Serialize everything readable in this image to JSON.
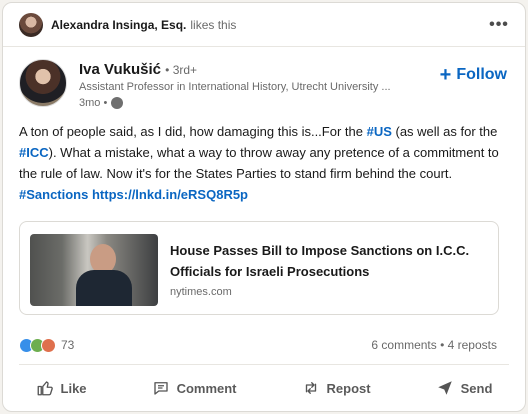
{
  "social_context": {
    "actor": "Alexandra Insinga, Esq.",
    "action": "likes this"
  },
  "author": {
    "name": "Iva Vukušić",
    "degree": "• 3rd+",
    "headline": "Assistant Professor in International History, Utrecht University ...",
    "time": "3mo •",
    "follow_label": "Follow"
  },
  "post": {
    "text_1": "A ton of people said, as I did, how damaging this is...For the ",
    "tag_us": "#US",
    "text_2": " (as well as for the ",
    "tag_icc": "#ICC",
    "text_3": "). What a mistake, what a way to throw away any pretence of a commitment to the rule of law. Now it's for the States Parties to stand firm behind the court. ",
    "tag_sanctions": "#Sanctions",
    "link": "https://lnkd.in/eRSQ8R5p"
  },
  "article": {
    "title": "House Passes Bill to Impose Sanctions on I.C.C. Officials for Israeli Prosecutions",
    "source": "nytimes.com"
  },
  "counts": {
    "reactions": "73",
    "comments_reposts": "6 comments • 4 reposts"
  },
  "actions": {
    "like": "Like",
    "comment": "Comment",
    "repost": "Repost",
    "send": "Send"
  }
}
